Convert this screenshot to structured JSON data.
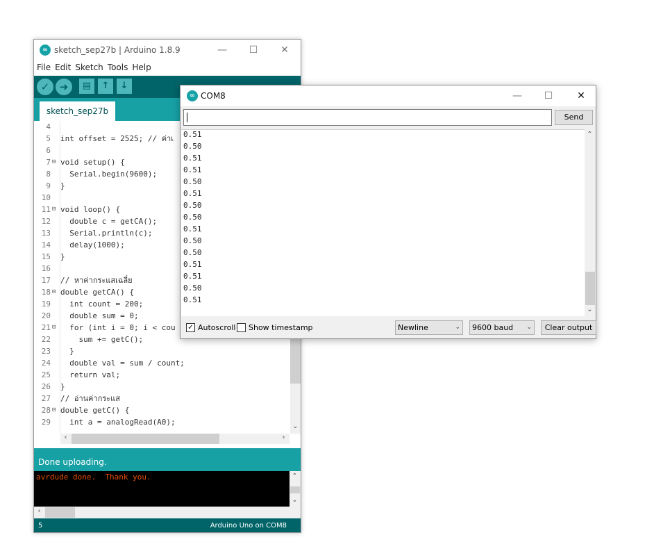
{
  "ide": {
    "title": "sketch_sep27b | Arduino 1.8.9",
    "menu": [
      "File",
      "Edit",
      "Sketch",
      "Tools",
      "Help"
    ],
    "tab_label": "sketch_sep27b",
    "code_lines": [
      {
        "n": "4",
        "fold": "",
        "text": ""
      },
      {
        "n": "5",
        "fold": "",
        "text": "int offset = 2525; // ค่าเ"
      },
      {
        "n": "6",
        "fold": "",
        "text": ""
      },
      {
        "n": "7",
        "fold": "⊟",
        "text": "void setup() {"
      },
      {
        "n": "8",
        "fold": "",
        "text": "  Serial.begin(9600);"
      },
      {
        "n": "9",
        "fold": "",
        "text": "}"
      },
      {
        "n": "10",
        "fold": "",
        "text": ""
      },
      {
        "n": "11",
        "fold": "⊟",
        "text": "void loop() {"
      },
      {
        "n": "12",
        "fold": "",
        "text": "  double c = getCA();"
      },
      {
        "n": "13",
        "fold": "",
        "text": "  Serial.println(c);"
      },
      {
        "n": "14",
        "fold": "",
        "text": "  delay(1000);"
      },
      {
        "n": "15",
        "fold": "",
        "text": "}"
      },
      {
        "n": "16",
        "fold": "",
        "text": ""
      },
      {
        "n": "17",
        "fold": "",
        "text": "// หาค่ากระแสเฉลี่ย"
      },
      {
        "n": "18",
        "fold": "⊟",
        "text": "double getCA() {"
      },
      {
        "n": "19",
        "fold": "",
        "text": "  int count = 200;"
      },
      {
        "n": "20",
        "fold": "",
        "text": "  double sum = 0;"
      },
      {
        "n": "21",
        "fold": "⊟",
        "text": "  for (int i = 0; i < cou"
      },
      {
        "n": "22",
        "fold": "",
        "text": "    sum += getC();"
      },
      {
        "n": "23",
        "fold": "",
        "text": "  }"
      },
      {
        "n": "24",
        "fold": "",
        "text": "  double val = sum / count;"
      },
      {
        "n": "25",
        "fold": "",
        "text": "  return val;"
      },
      {
        "n": "26",
        "fold": "",
        "text": "}"
      },
      {
        "n": "27",
        "fold": "",
        "text": "// อ่านค่ากระแส"
      },
      {
        "n": "28",
        "fold": "⊟",
        "text": "double getC() {"
      },
      {
        "n": "29",
        "fold": "",
        "text": "  int a = analogRead(A0);"
      }
    ],
    "status_message": "Done uploading.",
    "console_text": "avrdude done.  Thank you.",
    "line_number": "5",
    "board": "Arduino Uno on COM8"
  },
  "monitor": {
    "title": "COM8",
    "input_value": "",
    "send_label": "Send",
    "output": [
      "0.51",
      "0.50",
      "0.51",
      "0.51",
      "0.50",
      "0.51",
      "0.50",
      "0.50",
      "0.51",
      "0.50",
      "0.50",
      "0.51",
      "0.51",
      "0.50",
      "0.51"
    ],
    "autoscroll_label": "Autoscroll",
    "autoscroll_checked": true,
    "timestamp_label": "Show timestamp",
    "timestamp_checked": false,
    "line_ending": "Newline",
    "baud": "9600 baud",
    "clear_label": "Clear output"
  },
  "colors": {
    "accent": "#17a1a5",
    "toolbar": "#006468",
    "console_text": "#e34c00"
  }
}
